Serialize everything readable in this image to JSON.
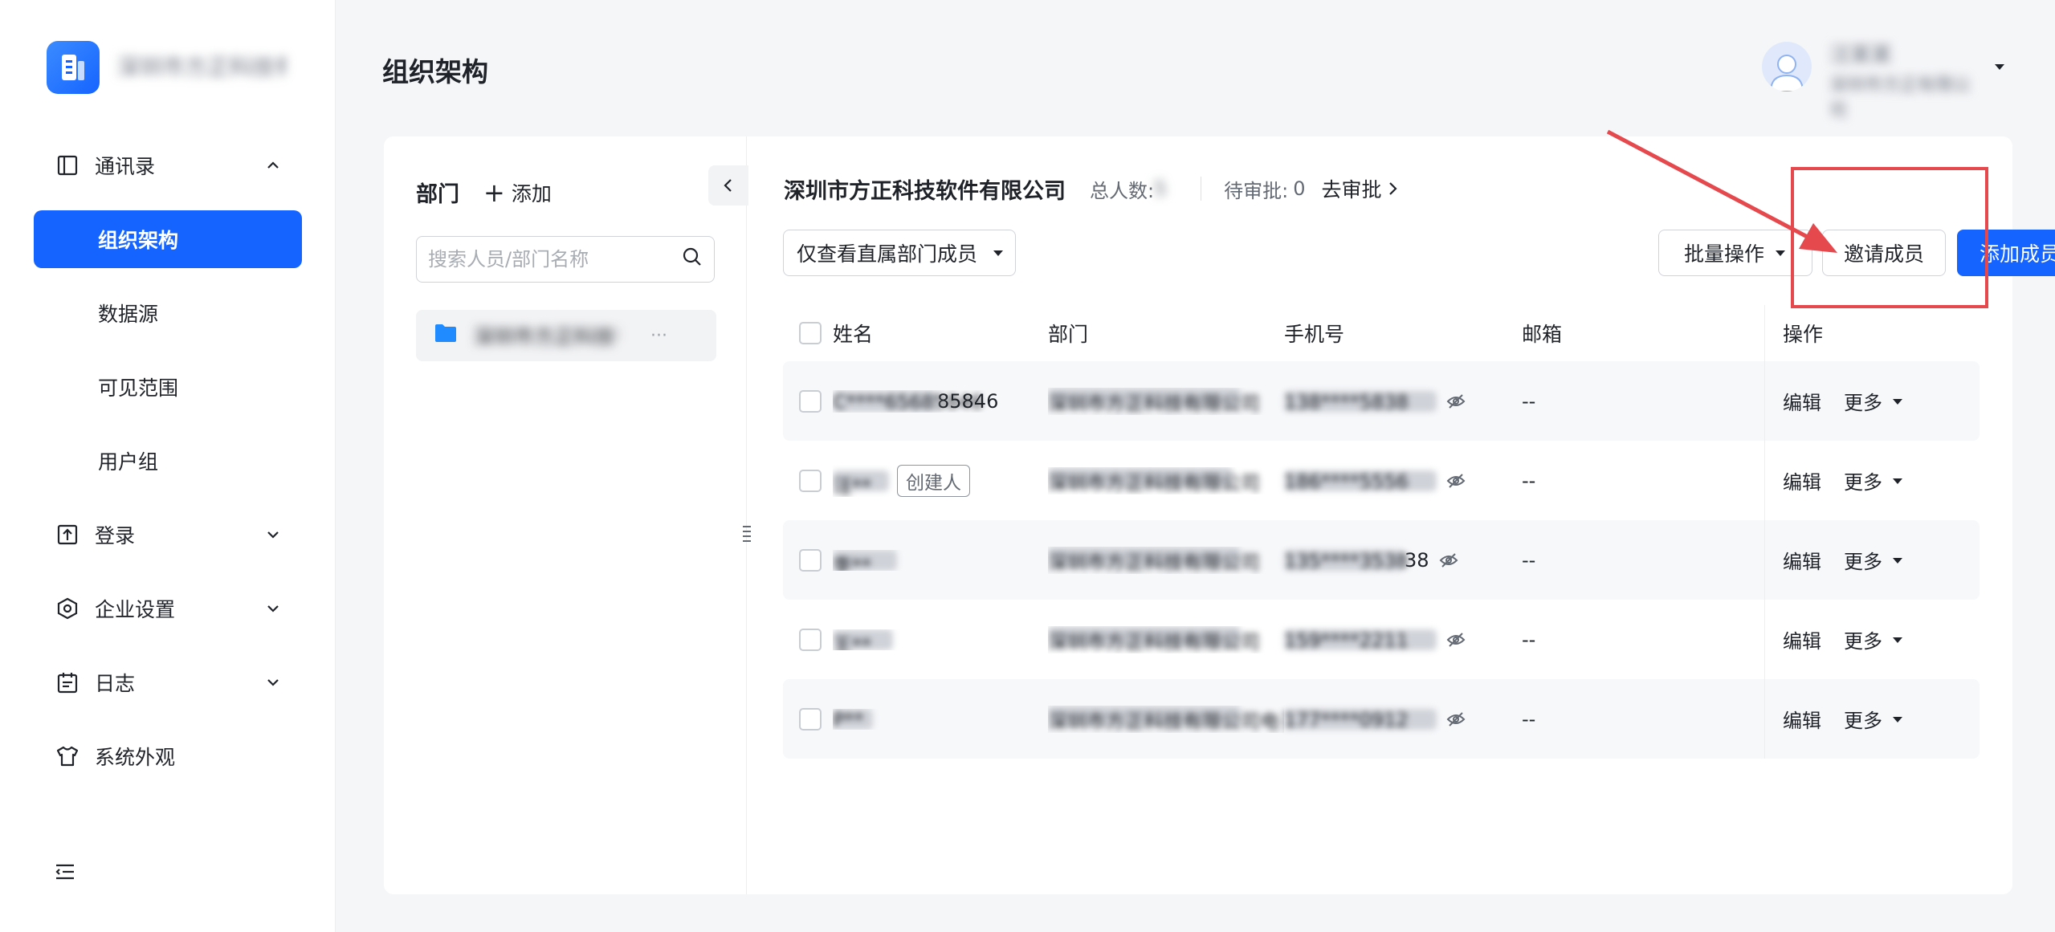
{
  "app": {
    "brand_name": "深圳市方正科技有限公司...",
    "brand_icon": "document-icon"
  },
  "sidebar": {
    "groups": [
      {
        "label": "通讯录",
        "icon": "address-book-icon",
        "expanded": true,
        "items": [
          {
            "label": "组织架构",
            "active": true
          },
          {
            "label": "数据源"
          },
          {
            "label": "可见范围"
          },
          {
            "label": "用户组"
          }
        ]
      },
      {
        "label": "登录",
        "icon": "login-icon"
      },
      {
        "label": "企业设置",
        "icon": "settings-icon"
      },
      {
        "label": "日志",
        "icon": "calendar-icon"
      },
      {
        "label": "系统外观",
        "icon": "shirt-icon"
      }
    ]
  },
  "header": {
    "title": "组织架构",
    "user": {
      "name": "汪某某",
      "org": "深圳市方正有限公司"
    }
  },
  "dept_panel": {
    "title": "部门",
    "add_label": "添加",
    "search_placeholder": "搜索人员/部门名称",
    "items": [
      {
        "name": "深圳市方正科技有限公司",
        "more": "···"
      }
    ]
  },
  "main": {
    "company_name": "深圳市方正科技软件有限公司",
    "total_label": "总人数:",
    "total_value": "5",
    "pending_label": "待审批:",
    "pending_count": "0",
    "approve_link": "去审批",
    "filter_label": "仅查看直属部门成员",
    "batch_label": "批量操作",
    "invite_label": "邀请成员",
    "add_member_label": "添加成员"
  },
  "table": {
    "columns": {
      "name": "姓名",
      "dept": "部门",
      "phone": "手机号",
      "email": "邮箱",
      "ops": "操作"
    },
    "edit_label": "编辑",
    "more_label": "更多",
    "rows": [
      {
        "name": "C****65685846",
        "name_visible": "85846",
        "tag": "",
        "dept": "深圳市方正科技有限公司",
        "phone": "138****5838",
        "email": "--"
      },
      {
        "name": "汪**",
        "name_visible": "",
        "tag": "创建人",
        "dept": "深圳市方正科技有限公司",
        "phone": "186****5556",
        "email": "--"
      },
      {
        "name": "李**",
        "name_visible": "",
        "tag": "",
        "dept": "深圳市方正科技有限公司",
        "phone": "135****3538",
        "email": "--"
      },
      {
        "name": "王**",
        "name_visible": "",
        "tag": "",
        "dept": "深圳市方正科技有限公司",
        "phone": "159****2211",
        "email": "--"
      },
      {
        "name": "P**",
        "name_visible": "",
        "tag": "",
        "dept": "深圳市方正科技有限公司电子...",
        "phone": "177****0912",
        "email": "--"
      }
    ],
    "phone_visible_suffix": "38"
  },
  "colors": {
    "primary": "#1664ff",
    "highlight": "#e5484d",
    "text": "#1f2329",
    "muted": "#646a73"
  }
}
